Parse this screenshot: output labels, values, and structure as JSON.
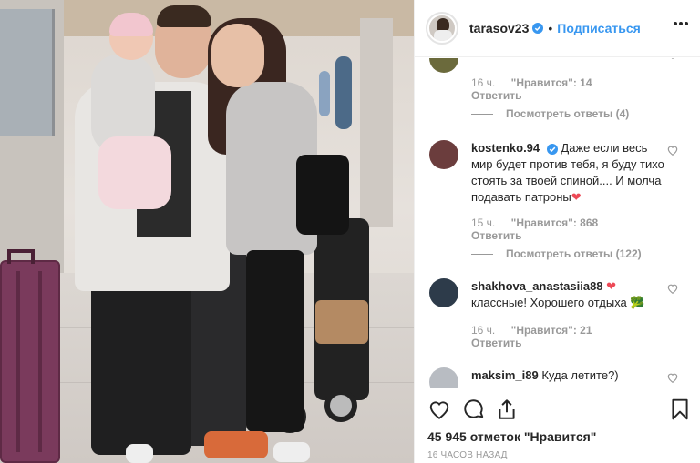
{
  "post": {
    "username": "tarasov23",
    "separator": "•",
    "follow_label": "Подписаться"
  },
  "comments": [
    {
      "username": "",
      "text": "",
      "time": "16 ч.",
      "likes": "\"Нравится\": 14",
      "reply_label": "Ответить",
      "view_replies": "Посмотреть ответы (4)"
    },
    {
      "username": "kostenko.94",
      "text": "Даже если весь мир будет против тебя, я буду тихо стоять за твоей спиной.... И молча подавать патроны",
      "emoji": "❤",
      "time": "15 ч.",
      "likes": "\"Нравится\": 868",
      "reply_label": "Ответить",
      "view_replies": "Посмотреть ответы (122)"
    },
    {
      "username": "shakhova_anastasiia88",
      "username_emoji": "❤",
      "text": "классные! Хорошего отдыха",
      "emoji": "🥦",
      "time": "16 ч.",
      "likes": "\"Нравится\": 21",
      "reply_label": "Ответить"
    },
    {
      "username": "maksim_i89",
      "text": "Куда летите?)"
    }
  ],
  "likes_count": "45 945 отметок \"Нравится\"",
  "timestamp": "16 ЧАСОВ НАЗАД",
  "colors": {
    "accent": "#3897f0",
    "heart": "#ed4956",
    "muted": "#999999",
    "text": "#262626"
  },
  "icons": [
    "verified-badge-icon",
    "more-icon",
    "like-heart-icon",
    "comment-icon",
    "share-icon",
    "bookmark-icon"
  ]
}
